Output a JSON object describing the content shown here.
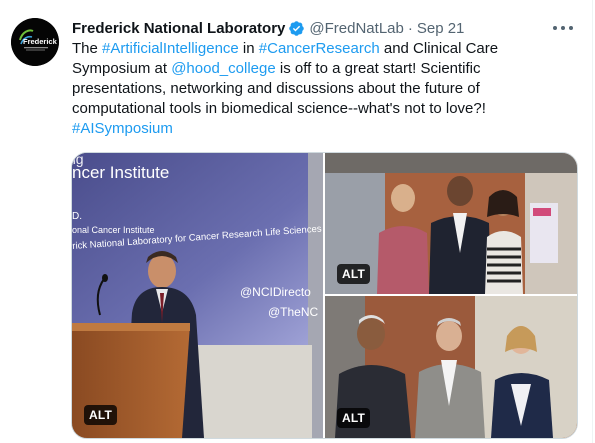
{
  "tweet": {
    "display_name": "Frederick National Laboratory",
    "handle": "@FredNatLab",
    "dot": "·",
    "date": "Sep 21",
    "avatar_logo_text": "Frederick",
    "text_parts": {
      "p1": "The ",
      "link1": "#ArtificialIntelligence",
      "p2": " in ",
      "link2": "#CancerResearch",
      "p3": " and Clinical Care Symposium at ",
      "link3": "@hood_college",
      "p4": "  is off to a great start! Scientific presentations, networking and discussions about the future of computational tools in biomedical science--what's not to love?! ",
      "link4": "#AISymposium"
    }
  },
  "media": {
    "alt_label": "ALT",
    "slide": {
      "line1": "ng",
      "line2": "ncer Institute",
      "line3": "D.",
      "line4": "onal Cancer Institute",
      "line5": "rick National Laboratory for Cancer Research Life Sciences",
      "handle1": "@NCIDirecto",
      "handle2": "@TheNC"
    }
  },
  "colors": {
    "link": "#1d9bf0",
    "verified": "#1d9bf0",
    "text": "#0f1419",
    "secondary": "#536471"
  }
}
